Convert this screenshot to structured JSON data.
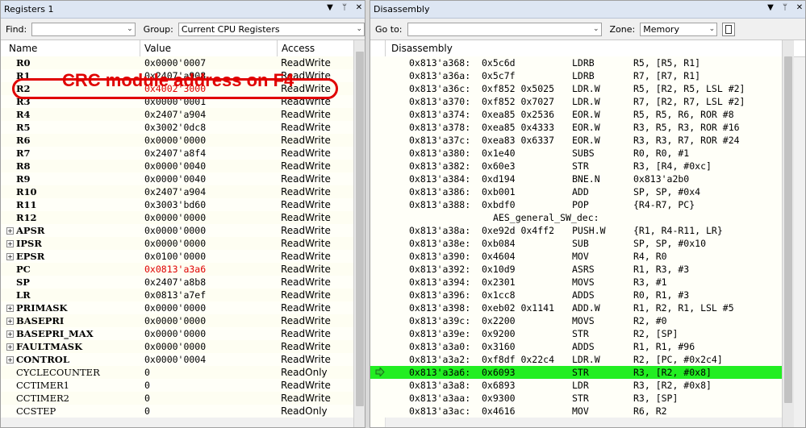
{
  "registers": {
    "title": "Registers 1",
    "find_label": "Find:",
    "find_value": "",
    "group_label": "Group:",
    "group_value": "Current CPU Registers",
    "columns": [
      "Name",
      "Value",
      "Access"
    ],
    "annotation": "CRC module address on F4",
    "rows": [
      {
        "name": "R0",
        "value": "0x0000'0007",
        "access": "ReadWrite"
      },
      {
        "name": "R1",
        "value": "0x2407'a908",
        "access": "ReadWrite"
      },
      {
        "name": "R2",
        "value": "0x4002'3000",
        "access": "ReadWrite",
        "red": true
      },
      {
        "name": "R3",
        "value": "0x0000'0001",
        "access": "ReadWrite"
      },
      {
        "name": "R4",
        "value": "0x2407'a904",
        "access": "ReadWrite"
      },
      {
        "name": "R5",
        "value": "0x3002'0dc8",
        "access": "ReadWrite"
      },
      {
        "name": "R6",
        "value": "0x0000'0000",
        "access": "ReadWrite"
      },
      {
        "name": "R7",
        "value": "0x2407'a8f4",
        "access": "ReadWrite"
      },
      {
        "name": "R8",
        "value": "0x0000'0040",
        "access": "ReadWrite"
      },
      {
        "name": "R9",
        "value": "0x0000'0040",
        "access": "ReadWrite"
      },
      {
        "name": "R10",
        "value": "0x2407'a904",
        "access": "ReadWrite"
      },
      {
        "name": "R11",
        "value": "0x3003'bd60",
        "access": "ReadWrite"
      },
      {
        "name": "R12",
        "value": "0x0000'0000",
        "access": "ReadWrite"
      },
      {
        "name": "APSR",
        "value": "0x0000'0000",
        "access": "ReadWrite",
        "expand": true
      },
      {
        "name": "IPSR",
        "value": "0x0000'0000",
        "access": "ReadWrite",
        "expand": true
      },
      {
        "name": "EPSR",
        "value": "0x0100'0000",
        "access": "ReadWrite",
        "expand": true
      },
      {
        "name": "PC",
        "value": "0x0813'a3a6",
        "access": "ReadWrite",
        "red": true
      },
      {
        "name": "SP",
        "value": "0x2407'a8b8",
        "access": "ReadWrite"
      },
      {
        "name": "LR",
        "value": "0x0813'a7ef",
        "access": "ReadWrite"
      },
      {
        "name": "PRIMASK",
        "value": "0x0000'0000",
        "access": "ReadWrite",
        "expand": true
      },
      {
        "name": "BASEPRI",
        "value": "0x0000'0000",
        "access": "ReadWrite",
        "expand": true
      },
      {
        "name": "BASEPRI_MAX",
        "value": "0x0000'0000",
        "access": "ReadWrite",
        "expand": true
      },
      {
        "name": "FAULTMASK",
        "value": "0x0000'0000",
        "access": "ReadWrite",
        "expand": true
      },
      {
        "name": "CONTROL",
        "value": "0x0000'0004",
        "access": "ReadWrite",
        "expand": true
      },
      {
        "name": "CYCLECOUNTER",
        "value": "0",
        "access": "ReadOnly",
        "plain": true
      },
      {
        "name": "CCTIMER1",
        "value": "0",
        "access": "ReadWrite",
        "plain": true
      },
      {
        "name": "CCTIMER2",
        "value": "0",
        "access": "ReadWrite",
        "plain": true
      },
      {
        "name": "CCSTEP",
        "value": "0",
        "access": "ReadOnly",
        "plain": true
      }
    ]
  },
  "disassembly": {
    "title": "Disassembly",
    "goto_label": "Go to:",
    "goto_value": "",
    "zone_label": "Zone:",
    "zone_value": "Memory",
    "header": "Disassembly",
    "rows": [
      {
        "addr": "0x813'a368:",
        "code": "0x5c6d",
        "mnem": "LDRB",
        "ops": "R5, [R5, R1]"
      },
      {
        "addr": "0x813'a36a:",
        "code": "0x5c7f",
        "mnem": "LDRB",
        "ops": "R7, [R7, R1]"
      },
      {
        "addr": "0x813'a36c:",
        "code": "0xf852 0x5025",
        "mnem": "LDR.W",
        "ops": "R5, [R2, R5, LSL #2]"
      },
      {
        "addr": "0x813'a370:",
        "code": "0xf852 0x7027",
        "mnem": "LDR.W",
        "ops": "R7, [R2, R7, LSL #2]"
      },
      {
        "addr": "0x813'a374:",
        "code": "0xea85 0x2536",
        "mnem": "EOR.W",
        "ops": "R5, R5, R6, ROR #8"
      },
      {
        "addr": "0x813'a378:",
        "code": "0xea85 0x4333",
        "mnem": "EOR.W",
        "ops": "R3, R5, R3, ROR #16"
      },
      {
        "addr": "0x813'a37c:",
        "code": "0xea83 0x6337",
        "mnem": "EOR.W",
        "ops": "R3, R3, R7, ROR #24"
      },
      {
        "addr": "0x813'a380:",
        "code": "0x1e40",
        "mnem": "SUBS",
        "ops": "R0, R0, #1"
      },
      {
        "addr": "0x813'a382:",
        "code": "0x60e3",
        "mnem": "STR",
        "ops": "R3, [R4, #0xc]"
      },
      {
        "addr": "0x813'a384:",
        "code": "0xd194",
        "mnem": "BNE.N",
        "ops": "0x813'a2b0"
      },
      {
        "addr": "0x813'a386:",
        "code": "0xb001",
        "mnem": "ADD",
        "ops": "SP, SP, #0x4"
      },
      {
        "addr": "0x813'a388:",
        "code": "0xbdf0",
        "mnem": "POP",
        "ops": "{R4-R7, PC}"
      },
      {
        "label": "AES_general_SW_dec:"
      },
      {
        "addr": "0x813'a38a:",
        "code": "0xe92d 0x4ff2",
        "mnem": "PUSH.W",
        "ops": "{R1, R4-R11, LR}"
      },
      {
        "addr": "0x813'a38e:",
        "code": "0xb084",
        "mnem": "SUB",
        "ops": "SP, SP, #0x10"
      },
      {
        "addr": "0x813'a390:",
        "code": "0x4604",
        "mnem": "MOV",
        "ops": "R4, R0"
      },
      {
        "addr": "0x813'a392:",
        "code": "0x10d9",
        "mnem": "ASRS",
        "ops": "R1, R3, #3"
      },
      {
        "addr": "0x813'a394:",
        "code": "0x2301",
        "mnem": "MOVS",
        "ops": "R3, #1"
      },
      {
        "addr": "0x813'a396:",
        "code": "0x1cc8",
        "mnem": "ADDS",
        "ops": "R0, R1, #3"
      },
      {
        "addr": "0x813'a398:",
        "code": "0xeb02 0x1141",
        "mnem": "ADD.W",
        "ops": "R1, R2, R1, LSL #5"
      },
      {
        "addr": "0x813'a39c:",
        "code": "0x2200",
        "mnem": "MOVS",
        "ops": "R2, #0"
      },
      {
        "addr": "0x813'a39e:",
        "code": "0x9200",
        "mnem": "STR",
        "ops": "R2, [SP]"
      },
      {
        "addr": "0x813'a3a0:",
        "code": "0x3160",
        "mnem": "ADDS",
        "ops": "R1, R1, #96"
      },
      {
        "addr": "0x813'a3a2:",
        "code": "0xf8df 0x22c4",
        "mnem": "LDR.W",
        "ops": "R2, [PC, #0x2c4]"
      },
      {
        "addr": "0x813'a3a6:",
        "code": "0x6093",
        "mnem": "STR",
        "ops": "R3, [R2, #0x8]",
        "current": true
      },
      {
        "addr": "0x813'a3a8:",
        "code": "0x6893",
        "mnem": "LDR",
        "ops": "R3, [R2, #0x8]"
      },
      {
        "addr": "0x813'a3aa:",
        "code": "0x9300",
        "mnem": "STR",
        "ops": "R3, [SP]"
      },
      {
        "addr": "0x813'a3ac:",
        "code": "0x4616",
        "mnem": "MOV",
        "ops": "R6, R2"
      }
    ]
  }
}
